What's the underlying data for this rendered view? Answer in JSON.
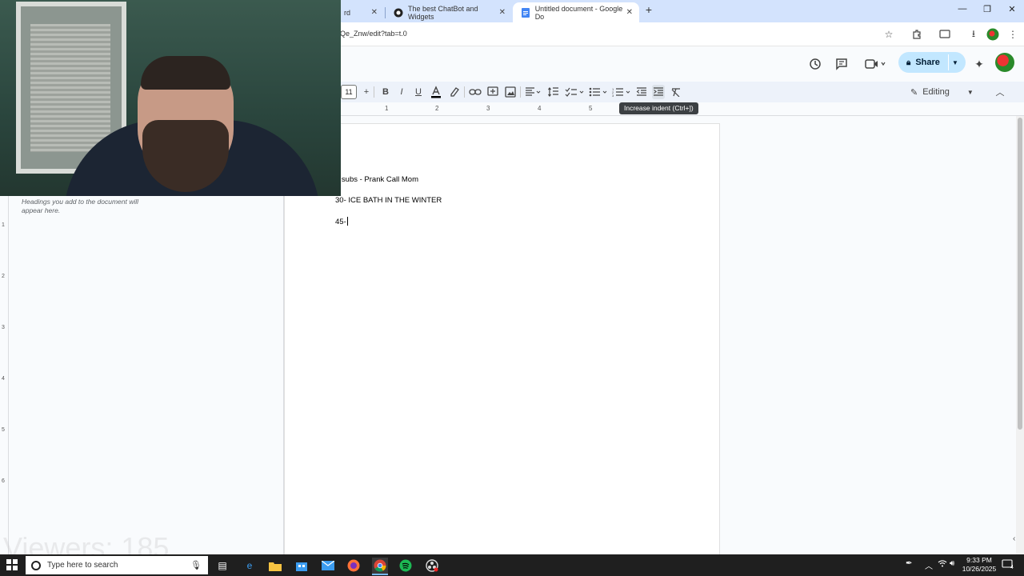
{
  "browser": {
    "tabs": [
      {
        "title": "rd",
        "active": false
      },
      {
        "title": "The best ChatBot and Widgets",
        "active": false
      },
      {
        "title": "Untitled document - Google Do",
        "active": true
      }
    ],
    "tab_close_glyph": "✕",
    "new_tab_glyph": "+",
    "url": "Qe_Znw/edit?tab=t.0"
  },
  "docs": {
    "share_label": "Share",
    "font_size": "11",
    "editing_label": "Editing",
    "tooltip": "Increase indent (Ctrl+])",
    "outline_hint": "Headings you add to the document will appear here."
  },
  "ruler": {
    "h_numbers": [
      "1",
      "2",
      "3",
      "4",
      "5"
    ],
    "v_numbers": [
      "1",
      "2",
      "3",
      "4",
      "5",
      "6"
    ]
  },
  "document": {
    "lines": [
      "5 subs - Prank Call Mom",
      "30- ICE BATH IN THE WINTER",
      "45-"
    ]
  },
  "overlay": {
    "viewers": "Viewers: 185"
  },
  "taskbar": {
    "search_placeholder": "Type here to search",
    "time": "9:33 PM",
    "date": "10/26/2025",
    "notification_count": "4"
  },
  "colors": {
    "tabstrip": "#d3e3fd",
    "toolbar": "#edf2fa",
    "share": "#c2e7ff",
    "taskbar": "#1f1f1f"
  }
}
